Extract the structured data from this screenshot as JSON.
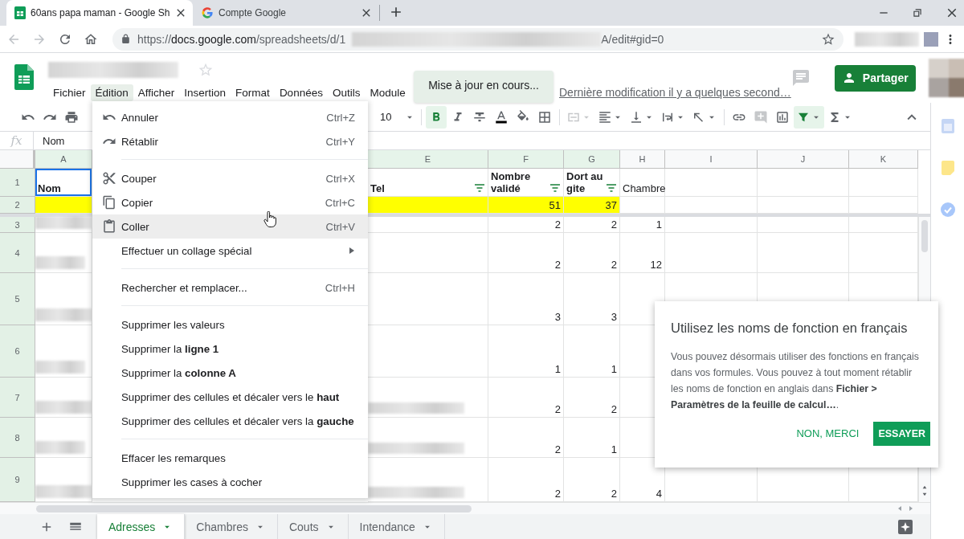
{
  "browser": {
    "tabs": [
      {
        "title": "60ans papa maman - Google Sh",
        "selected": true
      },
      {
        "title": "Compte Google",
        "selected": false
      }
    ],
    "url_start": "https://",
    "url_host": "docs.google.com",
    "url_path": "/spreadsheets/d/1",
    "url_end": "A/edit#gid=0"
  },
  "header": {
    "menus": [
      {
        "label": "Fichier",
        "selected": false
      },
      {
        "label": "Édition",
        "selected": true
      },
      {
        "label": "Afficher",
        "selected": false
      },
      {
        "label": "Insertion",
        "selected": false
      },
      {
        "label": "Format",
        "selected": false
      },
      {
        "label": "Données",
        "selected": false
      },
      {
        "label": "Outils",
        "selected": false
      },
      {
        "label": "Module",
        "selected": false
      }
    ],
    "last_edit": "Dernière modification il y a quelques second…",
    "share_button": "Partager"
  },
  "toast": "Mise à jour en cours...",
  "toolbar": {
    "font_size": "10",
    "tools": [
      {
        "active": true,
        "disabled": false
      },
      {
        "active": false,
        "disabled": false
      },
      {
        "active": false,
        "disabled": false
      },
      {
        "active": false,
        "disabled": false
      },
      {
        "active": false,
        "disabled": false
      },
      {
        "active": false,
        "disabled": false
      },
      {
        "active": false,
        "disabled": true
      },
      {
        "active": false,
        "disabled": false
      },
      {
        "active": false,
        "disabled": false
      },
      {
        "active": false,
        "disabled": false
      },
      {
        "active": false,
        "disabled": false
      },
      {
        "active": false,
        "disabled": false
      },
      {
        "active": false,
        "disabled": true
      },
      {
        "active": false,
        "disabled": false
      },
      {
        "active": true,
        "disabled": false
      },
      {
        "active": false,
        "disabled": false
      }
    ]
  },
  "formula_bar": {
    "label": "fx",
    "value": "Nom"
  },
  "grid": {
    "columns": [
      {
        "letter": "A",
        "highlighted": true
      },
      {
        "letter": "E",
        "highlighted": true
      },
      {
        "letter": "F",
        "highlighted": true
      },
      {
        "letter": "G",
        "highlighted": true
      },
      {
        "letter": "H",
        "highlighted": false
      },
      {
        "letter": "I",
        "highlighted": false
      },
      {
        "letter": "J",
        "highlighted": false
      },
      {
        "letter": "K",
        "highlighted": false
      }
    ],
    "rows": [
      {
        "number": "1",
        "highlighted": true,
        "cells": [
          {
            "text": "Nom",
            "kind": "text",
            "bold": true,
            "selected": true
          },
          {
            "text": "Tel",
            "kind": "text",
            "bold": true,
            "filter": true
          },
          {
            "text": "Nombre validé",
            "kind": "text",
            "bold": true,
            "filter": true
          },
          {
            "text": "Dort au gite",
            "kind": "text",
            "bold": true,
            "filter": true
          },
          {
            "text": "Chambre",
            "kind": "text"
          },
          null,
          null,
          null
        ]
      },
      {
        "number": "2",
        "highlighted": true,
        "cells": [
          {
            "highlighted": true
          },
          {
            "highlighted": true
          },
          {
            "text": "51",
            "kind": "number",
            "highlighted": true
          },
          {
            "text": "37",
            "kind": "number",
            "highlighted": true
          },
          null,
          null,
          null,
          null
        ]
      },
      {
        "number": "3",
        "highlighted": true,
        "cells": [
          {
            "kind": "blurred"
          },
          null,
          {
            "text": "2",
            "kind": "number"
          },
          {
            "text": "2",
            "kind": "number"
          },
          {
            "text": "1",
            "kind": "number"
          },
          null,
          null,
          null
        ]
      },
      {
        "number": "4",
        "highlighted": true,
        "cells": [
          {
            "kind": "blurred"
          },
          null,
          {
            "text": "2",
            "kind": "number"
          },
          {
            "text": "2",
            "kind": "number"
          },
          {
            "text": "12",
            "kind": "number"
          },
          null,
          null,
          null
        ]
      },
      {
        "number": "5",
        "highlighted": true,
        "cells": [
          {
            "kind": "blurred"
          },
          null,
          {
            "text": "3",
            "kind": "number"
          },
          {
            "text": "3",
            "kind": "number"
          },
          null,
          null,
          null,
          null
        ]
      },
      {
        "number": "6",
        "highlighted": true,
        "cells": [
          {
            "kind": "blurred"
          },
          null,
          {
            "text": "1",
            "kind": "number"
          },
          {
            "text": "1",
            "kind": "number"
          },
          null,
          null,
          null,
          null
        ]
      },
      {
        "number": "7",
        "highlighted": true,
        "cells": [
          {
            "kind": "blurred"
          },
          {
            "kind": "blurred"
          },
          {
            "text": "2",
            "kind": "number"
          },
          {
            "text": "2",
            "kind": "number"
          },
          null,
          null,
          null,
          null
        ]
      },
      {
        "number": "8",
        "highlighted": true,
        "cells": [
          {
            "kind": "blurred"
          },
          {
            "kind": "blurred"
          },
          {
            "text": "2",
            "kind": "number"
          },
          {
            "text": "1",
            "kind": "number"
          },
          null,
          null,
          null,
          null
        ]
      },
      {
        "number": "9",
        "highlighted": true,
        "cells": [
          {
            "kind": "blurred"
          },
          {
            "kind": "blurred"
          },
          {
            "text": "2",
            "kind": "number"
          },
          {
            "text": "2",
            "kind": "number"
          },
          {
            "text": "4",
            "kind": "number"
          },
          null,
          null,
          null
        ]
      }
    ]
  },
  "edit_menu": {
    "items": [
      {
        "kind": "item",
        "label": "Annuler",
        "shortcut": "Ctrl+Z",
        "hovered": false,
        "submenu": false
      },
      {
        "kind": "item",
        "label": "Rétablir",
        "shortcut": "Ctrl+Y",
        "hovered": false,
        "submenu": false
      },
      {
        "kind": "separator"
      },
      {
        "kind": "item",
        "label": "Couper",
        "shortcut": "Ctrl+X",
        "hovered": false,
        "submenu": false
      },
      {
        "kind": "item",
        "label": "Copier",
        "shortcut": "Ctrl+C",
        "hovered": false,
        "submenu": false
      },
      {
        "kind": "item",
        "label": "Coller",
        "shortcut": "Ctrl+V",
        "hovered": true,
        "submenu": false
      },
      {
        "kind": "item",
        "label": "Effectuer un collage spécial",
        "hovered": false,
        "submenu": true
      },
      {
        "kind": "separator"
      },
      {
        "kind": "item",
        "label": "Rechercher et remplacer...",
        "shortcut": "Ctrl+H",
        "hovered": false,
        "submenu": false
      },
      {
        "kind": "separator"
      },
      {
        "kind": "item",
        "label": "Supprimer les valeurs",
        "hovered": false,
        "submenu": false
      },
      {
        "kind": "item",
        "label": "Supprimer la **ligne 1**",
        "hovered": false,
        "submenu": false
      },
      {
        "kind": "item",
        "label": "Supprimer la **colonne A**",
        "hovered": false,
        "submenu": false
      },
      {
        "kind": "item",
        "label": "Supprimer des cellules et décaler vers le **haut**",
        "hovered": false,
        "submenu": false
      },
      {
        "kind": "item",
        "label": "Supprimer des cellules et décaler vers la **gauche**",
        "hovered": false,
        "submenu": false
      },
      {
        "kind": "separator"
      },
      {
        "kind": "item",
        "label": "Effacer les remarques",
        "hovered": false,
        "submenu": false
      },
      {
        "kind": "item",
        "label": "Supprimer les cases à cocher",
        "hovered": false,
        "submenu": false
      }
    ]
  },
  "tip_popup": {
    "title": "Utilisez les noms de fonction en français",
    "body": "Vous pouvez désormais utiliser des fonctions en français dans vos formules. Vous pouvez à tout moment rétablir les noms de fonction en anglais dans **Fichier > Paramètres de la feuille de calcul…**.",
    "dismiss": "NON, MERCI",
    "confirm": "ESSAYER"
  },
  "sheet_tabs": [
    {
      "label": "Adresses",
      "selected": true
    },
    {
      "label": "Chambres",
      "selected": false
    },
    {
      "label": "Couts",
      "selected": false
    },
    {
      "label": "Intendance",
      "selected": false
    }
  ]
}
